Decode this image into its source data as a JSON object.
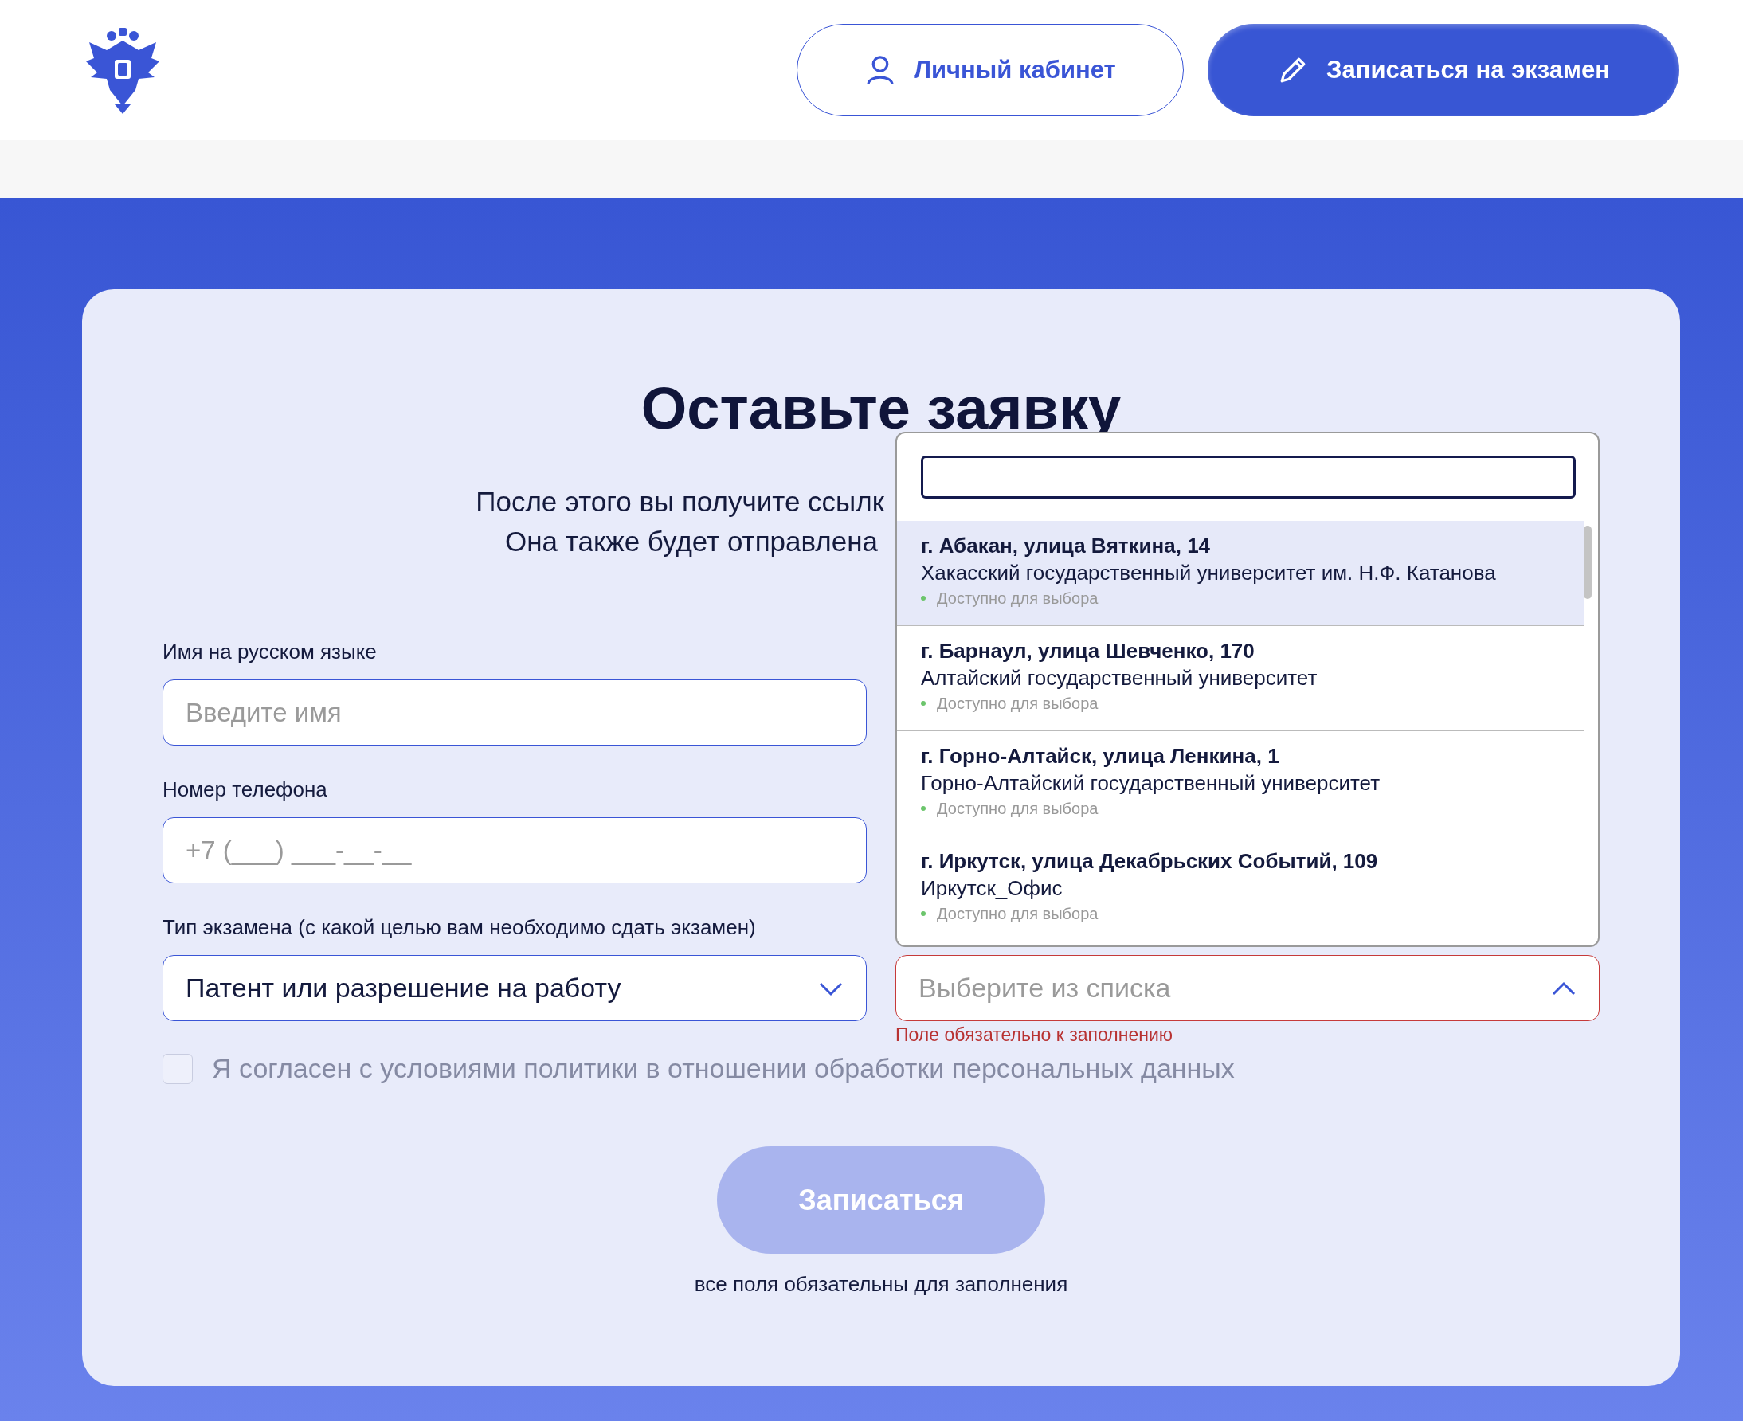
{
  "header": {
    "account_button": "Личный кабинет",
    "exam_button": "Записаться на экзамен"
  },
  "form": {
    "title": "Оставьте заявку",
    "subtitle_lines": [
      "После этого вы получите ссылк",
      "Она также будет отправлена"
    ],
    "fields": [
      {
        "label": "Имя на русском языке",
        "placeholder": "Введите имя"
      },
      {
        "label": "Номер телефона",
        "placeholder": "+7 (___) ___-__-__"
      }
    ],
    "exam_type": {
      "label": "Тип экзамена (с какой целью вам необходимо сдать экзамен)",
      "value": "Патент или разрешение на работу",
      "expanded": false
    },
    "center_select": {
      "placeholder": "Выберите из списка",
      "expanded": true,
      "error": "Поле обязательно к заполнению",
      "options": [
        {
          "address": "г. Абакан, улица Вяткина, 14",
          "name": "Хакасский государственный университет им. Н.Ф. Катанова",
          "status": "Доступно для выбора",
          "available": true,
          "selected": true
        },
        {
          "address": "г. Барнаул, улица Шевченко, 170",
          "name": "Алтайский государственный университет",
          "status": "Доступно для выбора",
          "available": true,
          "selected": false
        },
        {
          "address": "г. Горно-Алтайск, улица Ленкина, 1",
          "name": "Горно-Алтайский государственный университет",
          "status": "Доступно для выбора",
          "available": true,
          "selected": false
        },
        {
          "address": "г. Иркутск, улица Декабрьских Событий, 109",
          "name": "Иркутск_Офис",
          "status": "Доступно для выбора",
          "available": true,
          "selected": false
        }
      ]
    },
    "consent": {
      "text": "Я согласен с условиями политики в отношении обработки персональных данных",
      "checked": false
    },
    "submit": {
      "label": "Записаться",
      "disabled": true
    },
    "note": "все поля обязательны для заполнения"
  }
}
